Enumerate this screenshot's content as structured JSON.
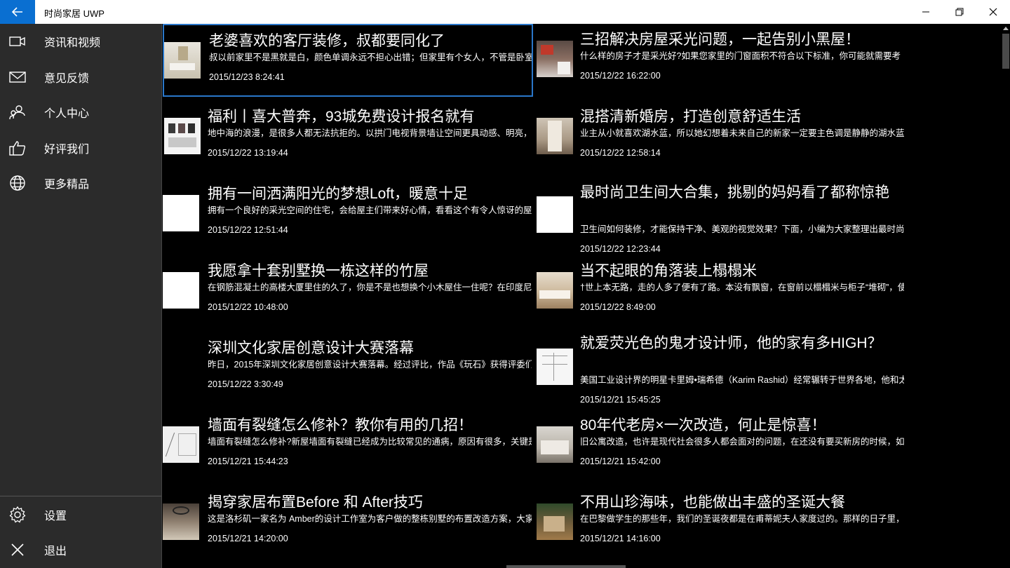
{
  "window": {
    "title": "时尚家居 UWP",
    "back_icon": "arrow-left-icon",
    "minimize_icon": "minimize-icon",
    "restore_icon": "restore-icon",
    "close_icon": "close-icon",
    "accent_color": "#0a6fd1"
  },
  "sidebar": {
    "items": [
      {
        "label": "资讯和视频",
        "icon": "video-camera-icon"
      },
      {
        "label": "意见反馈",
        "icon": "mail-icon"
      },
      {
        "label": "个人中心",
        "icon": "people-icon"
      },
      {
        "label": "好评我们",
        "icon": "thumbs-up-icon"
      },
      {
        "label": "更多精品",
        "icon": "globe-icon"
      }
    ],
    "bottom_items": [
      {
        "label": "设置",
        "icon": "gear-icon"
      },
      {
        "label": "退出",
        "icon": "close-icon"
      }
    ]
  },
  "articles": [
    {
      "title": "老婆喜欢的客厅装修，叔都要同化了",
      "summary": "叔以前家里不是黑就是白，颜色单调永远不担心出错；但家里有个女人，不管是卧室",
      "date": "2015/12/23 8:24:41"
    },
    {
      "title": "三招解决房屋采光问题，一起告别小黑屋！",
      "summary": "什么样的房子才是采光好?如果您家里的门窗面积不符合以下标准，你可能就需要考",
      "date": "2015/12/22 16:22:00"
    },
    {
      "title": "福利丨喜大普奔，93城免费设计报名就有",
      "summary": "地中海的浪漫，是很多人都无法抗拒的。以拱门电视背景墙让空间更具动感、明亮，",
      "date": "2015/12/22 13:19:44"
    },
    {
      "title": "混搭清新婚房，打造创意舒适生活",
      "summary": "业主从小就喜欢湖水蓝，所以她幻想着未来自己的新家一定要主色调是静静的湖水蓝",
      "date": "2015/12/22 12:58:14"
    },
    {
      "title": "拥有一间洒满阳光的梦想Loft，暖意十足",
      "summary": "拥有一个良好的采光空间的住宅，会给屋主们带来好心情，看看这个有令人惊讶的屋",
      "date": "2015/12/22 12:51:44"
    },
    {
      "title": "最时尚卫生间大合集，挑剔的妈妈看了都称惊艳",
      "summary": "卫生间如何装修，才能保持干净、美观的视觉效果？下面，小编为大家整理出最时尚",
      "date": "2015/12/22 12:23:44"
    },
    {
      "title": "我愿拿十套别墅换一栋这样的竹屋",
      "summary": "在钢筋混凝土的高楼大厦里住的久了，你是不是也想换个小木屋住一住呢？在印度尼",
      "date": "2015/12/22 10:48:00"
    },
    {
      "title": "当不起眼的角落装上榻榻米",
      "summary": "†世上本无路，走的人多了便有了路。本没有飘窗，在窗前以榻榻米与柜子“堆砌”，使",
      "date": "2015/12/22 8:49:00"
    },
    {
      "title": "深圳文化家居创意设计大赛落幕",
      "summary": "昨日，2015年深圳文化家居创意设计大赛落幕。经过评比，作品《玩石》获得评委们",
      "date": "2015/12/22 3:30:49"
    },
    {
      "title": "就爱荧光色的鬼才设计师，他的家有多HIGH？",
      "summary": "美国工业设计界的明星卡里姆•瑞希德（Karim Rashid）经常辗转于世界各地，他和太太",
      "date": "2015/12/21 15:45:25"
    },
    {
      "title": "墙面有裂缝怎么修补？教你有用的几招！",
      "summary": "墙面有裂缝怎么修补?新屋墙面有裂缝已经成为比较常见的通病，原因有很多，关键是",
      "date": "2015/12/21 15:44:23"
    },
    {
      "title": "80年代老房×一次改造，何止是惊喜！",
      "summary": "旧公寓改造，也许是现代社会很多人都会面对的问题，在还没有要买新房的时候，如何",
      "date": "2015/12/21 15:42:00"
    },
    {
      "title": "揭穿家居布置Before 和 After技巧",
      "summary": "这是洛杉矶一家名为 Amber的设计工作室为客户做的整栋别墅的布置改造方案，大家",
      "date": "2015/12/21 14:20:00"
    },
    {
      "title": "不用山珍海味，也能做出丰盛的圣诞大餐",
      "summary": "在巴黎做学生的那些年，我们的圣诞夜都是在甫蒂妮夫人家度过的。那样的日子里，",
      "date": "2015/12/21 14:16:00"
    }
  ]
}
